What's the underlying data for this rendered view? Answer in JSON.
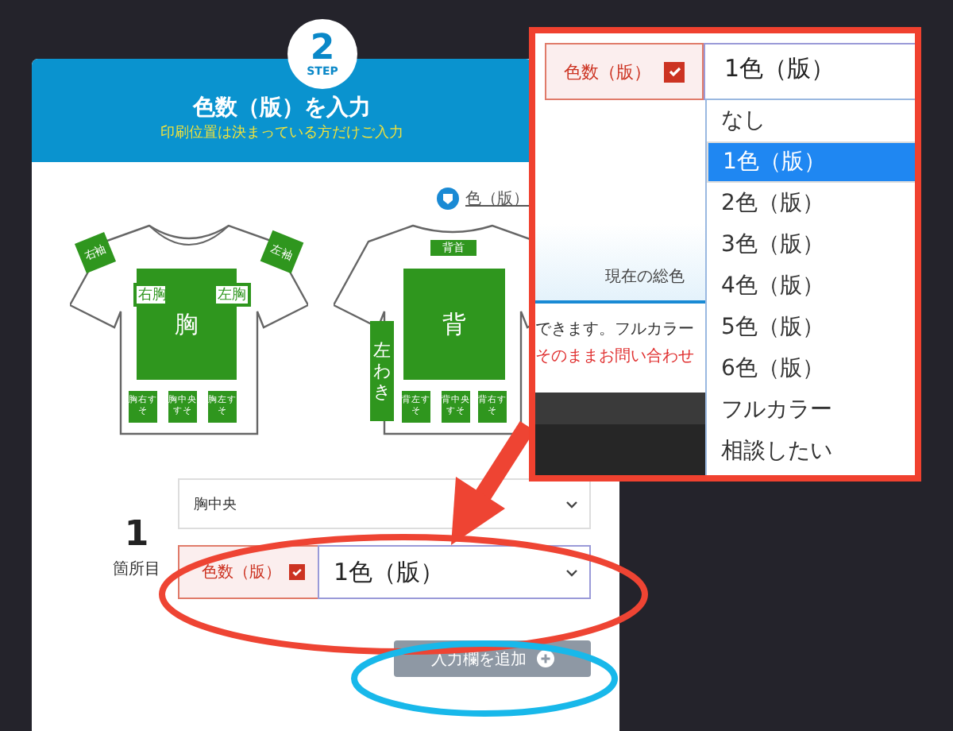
{
  "step": {
    "number": "2",
    "label": "STEP"
  },
  "header": {
    "title": "色数（版）を入力",
    "subtitle": "印刷位置は決まっている方だけご入力"
  },
  "color_link": "色（版）",
  "front_areas": [
    {
      "label": "右袖"
    },
    {
      "label": "左袖"
    },
    {
      "label": "胸"
    },
    {
      "label": "右胸"
    },
    {
      "label": "左胸"
    },
    {
      "label": "胸右すそ"
    },
    {
      "label": "胸中央すそ"
    },
    {
      "label": "胸左すそ"
    }
  ],
  "back_areas": [
    {
      "label": "背首"
    },
    {
      "label": "背"
    },
    {
      "label": "左わき"
    },
    {
      "label": "背左すそ"
    },
    {
      "label": "背中央すそ"
    },
    {
      "label": "背右すそ"
    }
  ],
  "entry": {
    "number": "1",
    "unit": "箇所目",
    "position": "胸中央",
    "color_label": "色数（版）",
    "checked": true,
    "color_value": "1色（版）"
  },
  "add_button": "入力欄を追加",
  "callout": {
    "color_label": "色数（版）",
    "checked": true,
    "value": "1色（版）",
    "total_text": "現在の総色",
    "note_text": "できます。フルカラー",
    "note_red": "そのままお問い合わせ",
    "options": [
      {
        "label": "なし",
        "selected": false
      },
      {
        "label": "1色（版）",
        "selected": true
      },
      {
        "label": "2色（版）",
        "selected": false
      },
      {
        "label": "3色（版）",
        "selected": false
      },
      {
        "label": "4色（版）",
        "selected": false
      },
      {
        "label": "5色（版）",
        "selected": false
      },
      {
        "label": "6色（版）",
        "selected": false
      },
      {
        "label": "フルカラー",
        "selected": false
      },
      {
        "label": "相談したい",
        "selected": false
      }
    ]
  }
}
